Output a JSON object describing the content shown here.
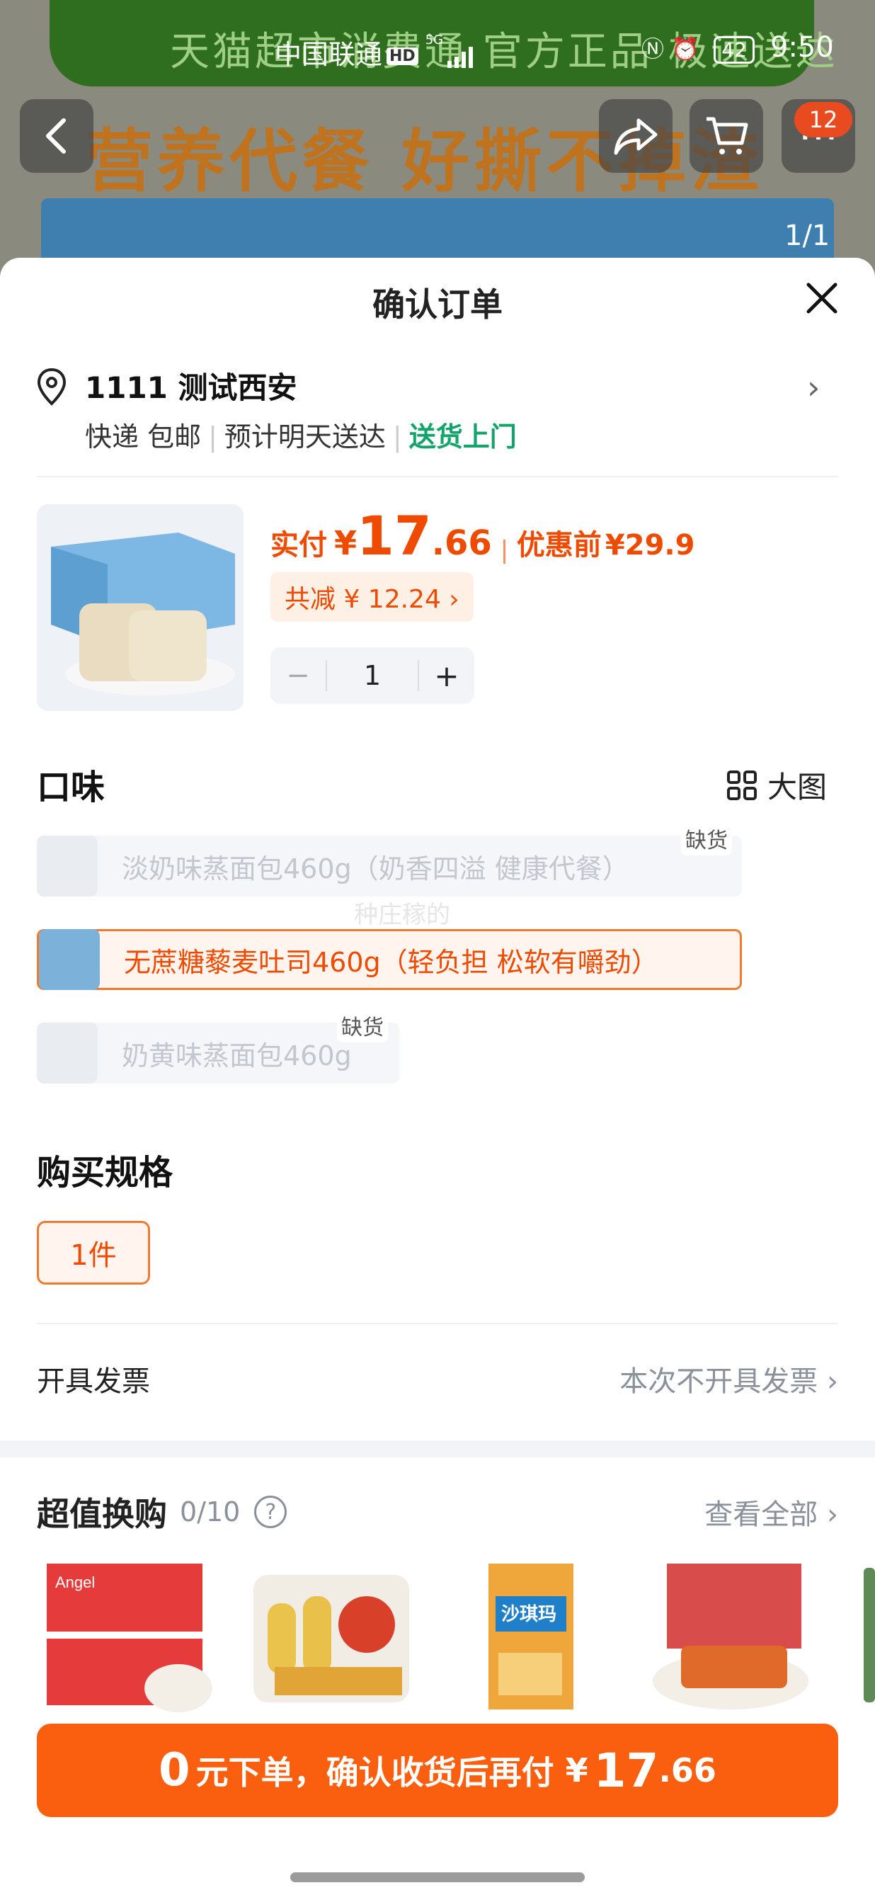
{
  "background": {
    "banner_text": "天猫超市消费通 官方正品 极速送达",
    "slogan": "营养代餐   好撕不掉渣",
    "pager": "1/1",
    "cart_badge": "12"
  },
  "status_bar": {
    "carrier": "中国联通",
    "hd": "HD",
    "network": "5G",
    "battery": "42",
    "time": "9:50"
  },
  "sheet": {
    "title": "确认订单"
  },
  "address": {
    "name": "1111 测试西安",
    "delivery_method": "快递 包邮",
    "eta": "预计明天送达",
    "door": "送货上门"
  },
  "product": {
    "paid_label": "实付",
    "currency": "¥",
    "price_int": "17",
    "price_dec": ".66",
    "orig_label": "优惠前",
    "orig_price": "¥29.9",
    "savings": "共减 ¥ 12.24 ›",
    "quantity": "1",
    "minus": "−",
    "plus": "+"
  },
  "flavor": {
    "title": "口味",
    "bigview_label": "大图",
    "options": [
      {
        "label": "淡奶味蒸面包460g（奶香四溢 健康代餐）",
        "status": "缺货"
      },
      {
        "label": "无蔗糖藜麦吐司460g（轻负担 松软有嚼劲）",
        "status": ""
      },
      {
        "label": "奶黄味蒸面包460g",
        "status": "缺货"
      }
    ],
    "watermark": "种庄稼的"
  },
  "spec": {
    "title": "购买规格",
    "option": "1件"
  },
  "invoice": {
    "label": "开具发票",
    "value": "本次不开具发票 ›"
  },
  "swap": {
    "title": "超值换购",
    "count": "0/10",
    "help": "?",
    "view_all": "查看全部 ›",
    "item_labels": [
      "Angel",
      "沙琪玛"
    ]
  },
  "cta": {
    "zero": "0",
    "text": "元下单，确认收货后再付",
    "currency": "¥",
    "amount_int": "17",
    "amount_dec": ".66"
  },
  "colors": {
    "accent": "#fa5e0f",
    "price": "#ee4a00",
    "green": "#12a46a"
  }
}
